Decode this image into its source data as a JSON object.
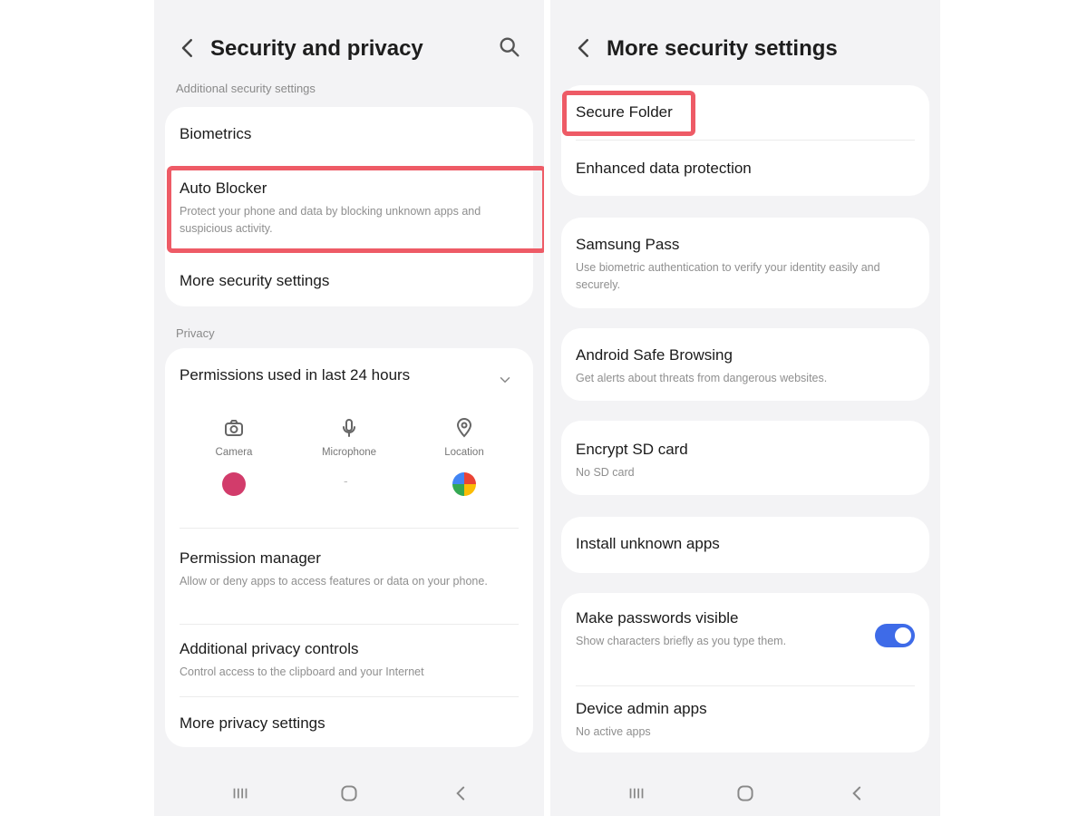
{
  "left": {
    "title": "Security and privacy",
    "section_security": "Additional security settings",
    "biometrics": "Biometrics",
    "auto_blocker": {
      "title": "Auto Blocker",
      "subtitle": "Protect your phone and data by blocking unknown apps and suspicious activity."
    },
    "more_security": "More security settings",
    "section_privacy": "Privacy",
    "permissions_used": "Permissions used in last 24 hours",
    "perm_items": [
      {
        "label": "Camera"
      },
      {
        "label": "Microphone"
      },
      {
        "label": "Location"
      }
    ],
    "perm_empty": "-",
    "permission_manager": {
      "title": "Permission manager",
      "subtitle": "Allow or deny apps to access features or data on your phone."
    },
    "additional_privacy": {
      "title": "Additional privacy controls",
      "subtitle": "Control access to the clipboard and your Internet"
    },
    "more_privacy": "More privacy settings"
  },
  "right": {
    "title": "More security settings",
    "secure_folder": "Secure Folder",
    "enhanced_data": "Enhanced data protection",
    "samsung_pass": {
      "title": "Samsung Pass",
      "subtitle": "Use biometric authentication to verify your identity easily and securely."
    },
    "android_safe": {
      "title": "Android Safe Browsing",
      "subtitle": "Get alerts about threats from dangerous websites."
    },
    "encrypt_sd": {
      "title": "Encrypt SD card",
      "subtitle": "No SD card"
    },
    "install_unknown": "Install unknown apps",
    "make_passwords": {
      "title": "Make passwords visible",
      "subtitle": "Show characters briefly as you type them."
    },
    "make_passwords_on": true,
    "device_admin": {
      "title": "Device admin apps",
      "subtitle": "No active apps"
    }
  },
  "colors": {
    "highlight": "#ee5b66",
    "accent": "#3e6be8"
  },
  "icons": [
    "back-icon",
    "search-icon",
    "camera-icon",
    "microphone-icon",
    "location-icon",
    "chevron-down-icon",
    "recents-icon",
    "home-icon",
    "nav-back-icon"
  ]
}
